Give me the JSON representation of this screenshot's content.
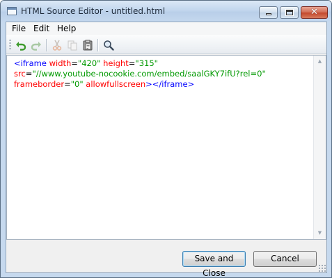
{
  "window": {
    "title": "HTML Source Editor - untitled.html",
    "close_glyph": "✕"
  },
  "menu": {
    "items": [
      {
        "label": "File"
      },
      {
        "label": "Edit"
      },
      {
        "label": "Help"
      }
    ]
  },
  "toolbar": {
    "buttons": [
      {
        "icon": "undo-icon",
        "enabled": true
      },
      {
        "icon": "redo-icon",
        "enabled": false
      },
      {
        "icon": "cut-icon",
        "enabled": false
      },
      {
        "icon": "copy-icon",
        "enabled": false
      },
      {
        "icon": "paste-icon",
        "enabled": true
      },
      {
        "icon": "find-icon",
        "enabled": true
      }
    ]
  },
  "editor": {
    "lines": [
      [
        {
          "type": "tag",
          "text": "<iframe"
        },
        {
          "type": "attr",
          "text": " width"
        },
        {
          "type": "eq",
          "text": "="
        },
        {
          "type": "val",
          "text": "\"420\""
        },
        {
          "type": "attr",
          "text": " height"
        },
        {
          "type": "eq",
          "text": "="
        },
        {
          "type": "val",
          "text": "\"315\""
        }
      ],
      [
        {
          "type": "attr",
          "text": "src"
        },
        {
          "type": "eq",
          "text": "="
        },
        {
          "type": "val",
          "text": "\"//www.youtube-nocookie.com/embed/saalGKY7ifU?rel=0\""
        }
      ],
      [
        {
          "type": "attr",
          "text": "frameborder"
        },
        {
          "type": "eq",
          "text": "="
        },
        {
          "type": "val",
          "text": "\"0\""
        },
        {
          "type": "attr",
          "text": " allowfullscreen"
        },
        {
          "type": "tag",
          "text": "></iframe>"
        }
      ]
    ]
  },
  "buttons": {
    "save_label": "Save and Close",
    "cancel_label": "Cancel"
  },
  "colors": {
    "tag": "#0000ff",
    "attribute": "#ff0000",
    "value": "#009900",
    "titlebar": "#c6d9ee"
  }
}
